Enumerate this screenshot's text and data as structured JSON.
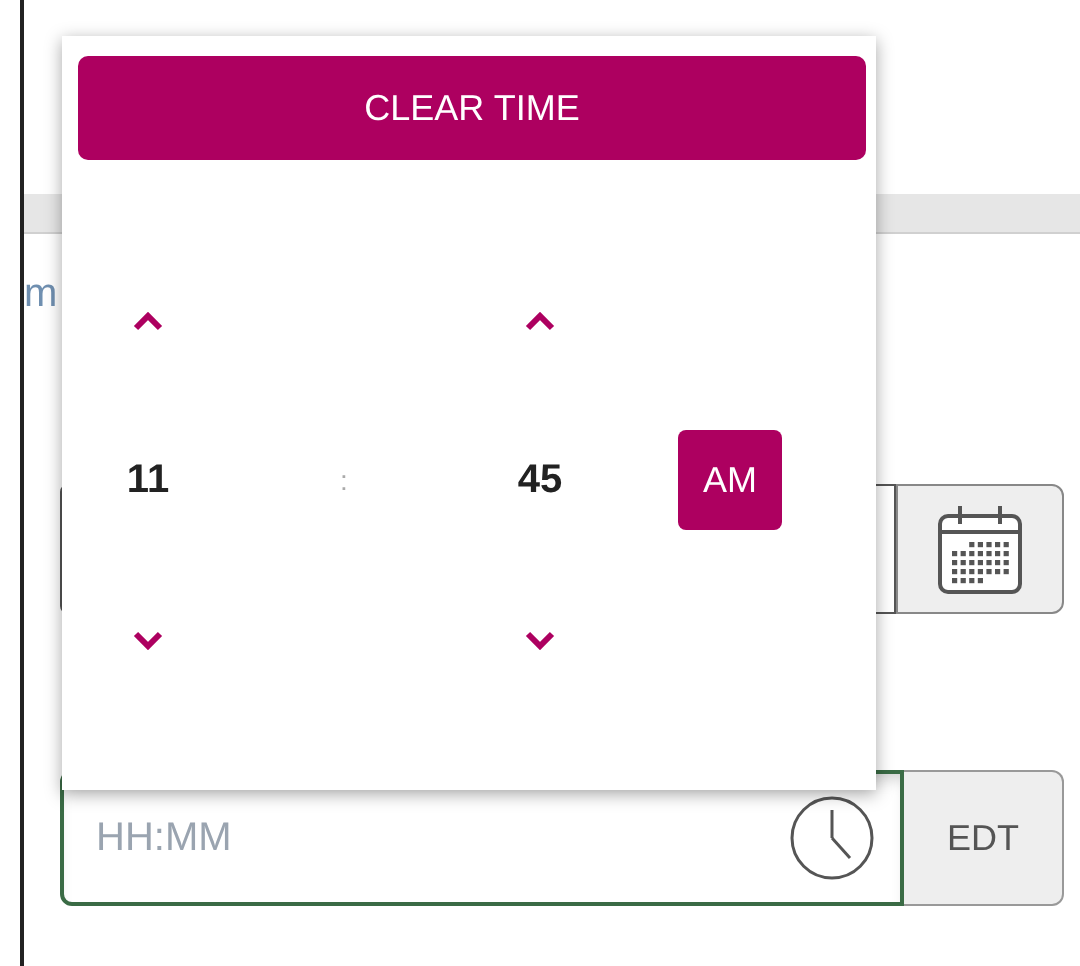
{
  "page": {
    "label_fragment": "m"
  },
  "time_field": {
    "placeholder": "HH:MM",
    "timezone": "EDT"
  },
  "time_picker": {
    "clear_button": "CLEAR TIME",
    "hour": "11",
    "separator": ":",
    "minute": "45",
    "period": "AM"
  }
}
